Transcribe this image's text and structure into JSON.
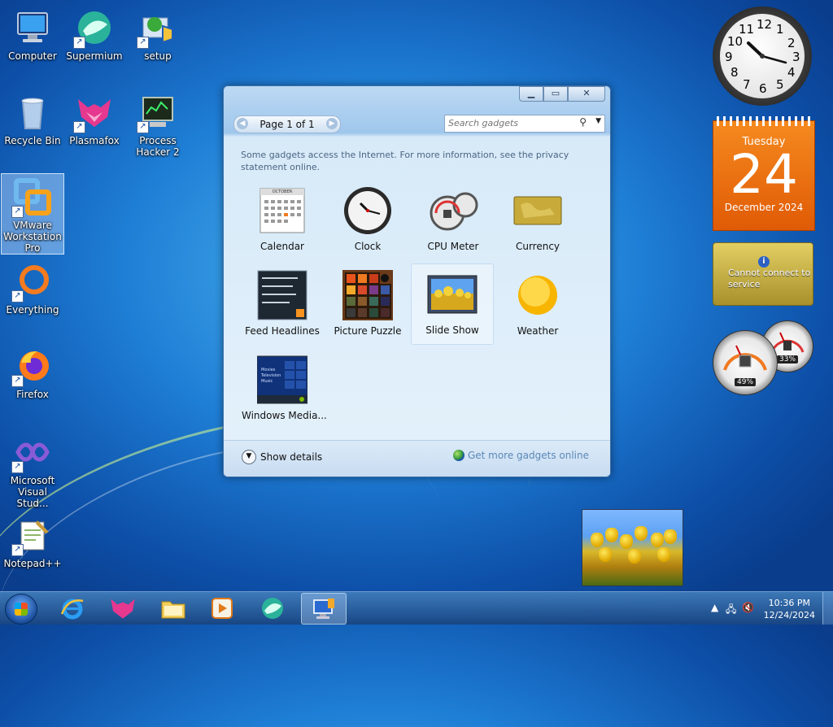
{
  "desktop": {
    "icons": [
      {
        "label": "Computer"
      },
      {
        "label": "Supermium"
      },
      {
        "label": "setup"
      },
      {
        "label": "Recycle Bin"
      },
      {
        "label": "Plasmafox"
      },
      {
        "label": "Process Hacker 2"
      },
      {
        "label": "VMware Workstation Pro"
      },
      {
        "label": "Everything"
      },
      {
        "label": "Firefox"
      },
      {
        "label": "Microsoft Visual Stud..."
      },
      {
        "label": "Notepad++"
      }
    ]
  },
  "gadget_window": {
    "pager_label": "Page 1 of 1",
    "search_placeholder": "Search gadgets",
    "notice": "Some gadgets access the Internet.  For more information, see the privacy statement online.",
    "gadgets": [
      {
        "label": "Calendar"
      },
      {
        "label": "Clock"
      },
      {
        "label": "CPU Meter"
      },
      {
        "label": "Currency"
      },
      {
        "label": "Feed Headlines"
      },
      {
        "label": "Picture Puzzle"
      },
      {
        "label": "Slide Show"
      },
      {
        "label": "Weather"
      },
      {
        "label": "Windows Media..."
      }
    ],
    "show_details": "Show details",
    "get_more": "Get more gadgets online",
    "calendar_thumb_month": "OCTOBER",
    "wmc_thumb_lines": [
      "Movies",
      "Television",
      "Music"
    ]
  },
  "side_gadgets": {
    "clock_numbers": [
      "12",
      "1",
      "2",
      "3",
      "4",
      "5",
      "6",
      "7",
      "8",
      "9",
      "10",
      "11"
    ],
    "calendar": {
      "weekday": "Tuesday",
      "day": "24",
      "month_year": "December 2024"
    },
    "currency_message": "Cannot connect to service",
    "cpu_percent": "49%",
    "memory_percent": "33%"
  },
  "taskbar": {
    "time": "10:36 PM",
    "date": "12/24/2024"
  }
}
